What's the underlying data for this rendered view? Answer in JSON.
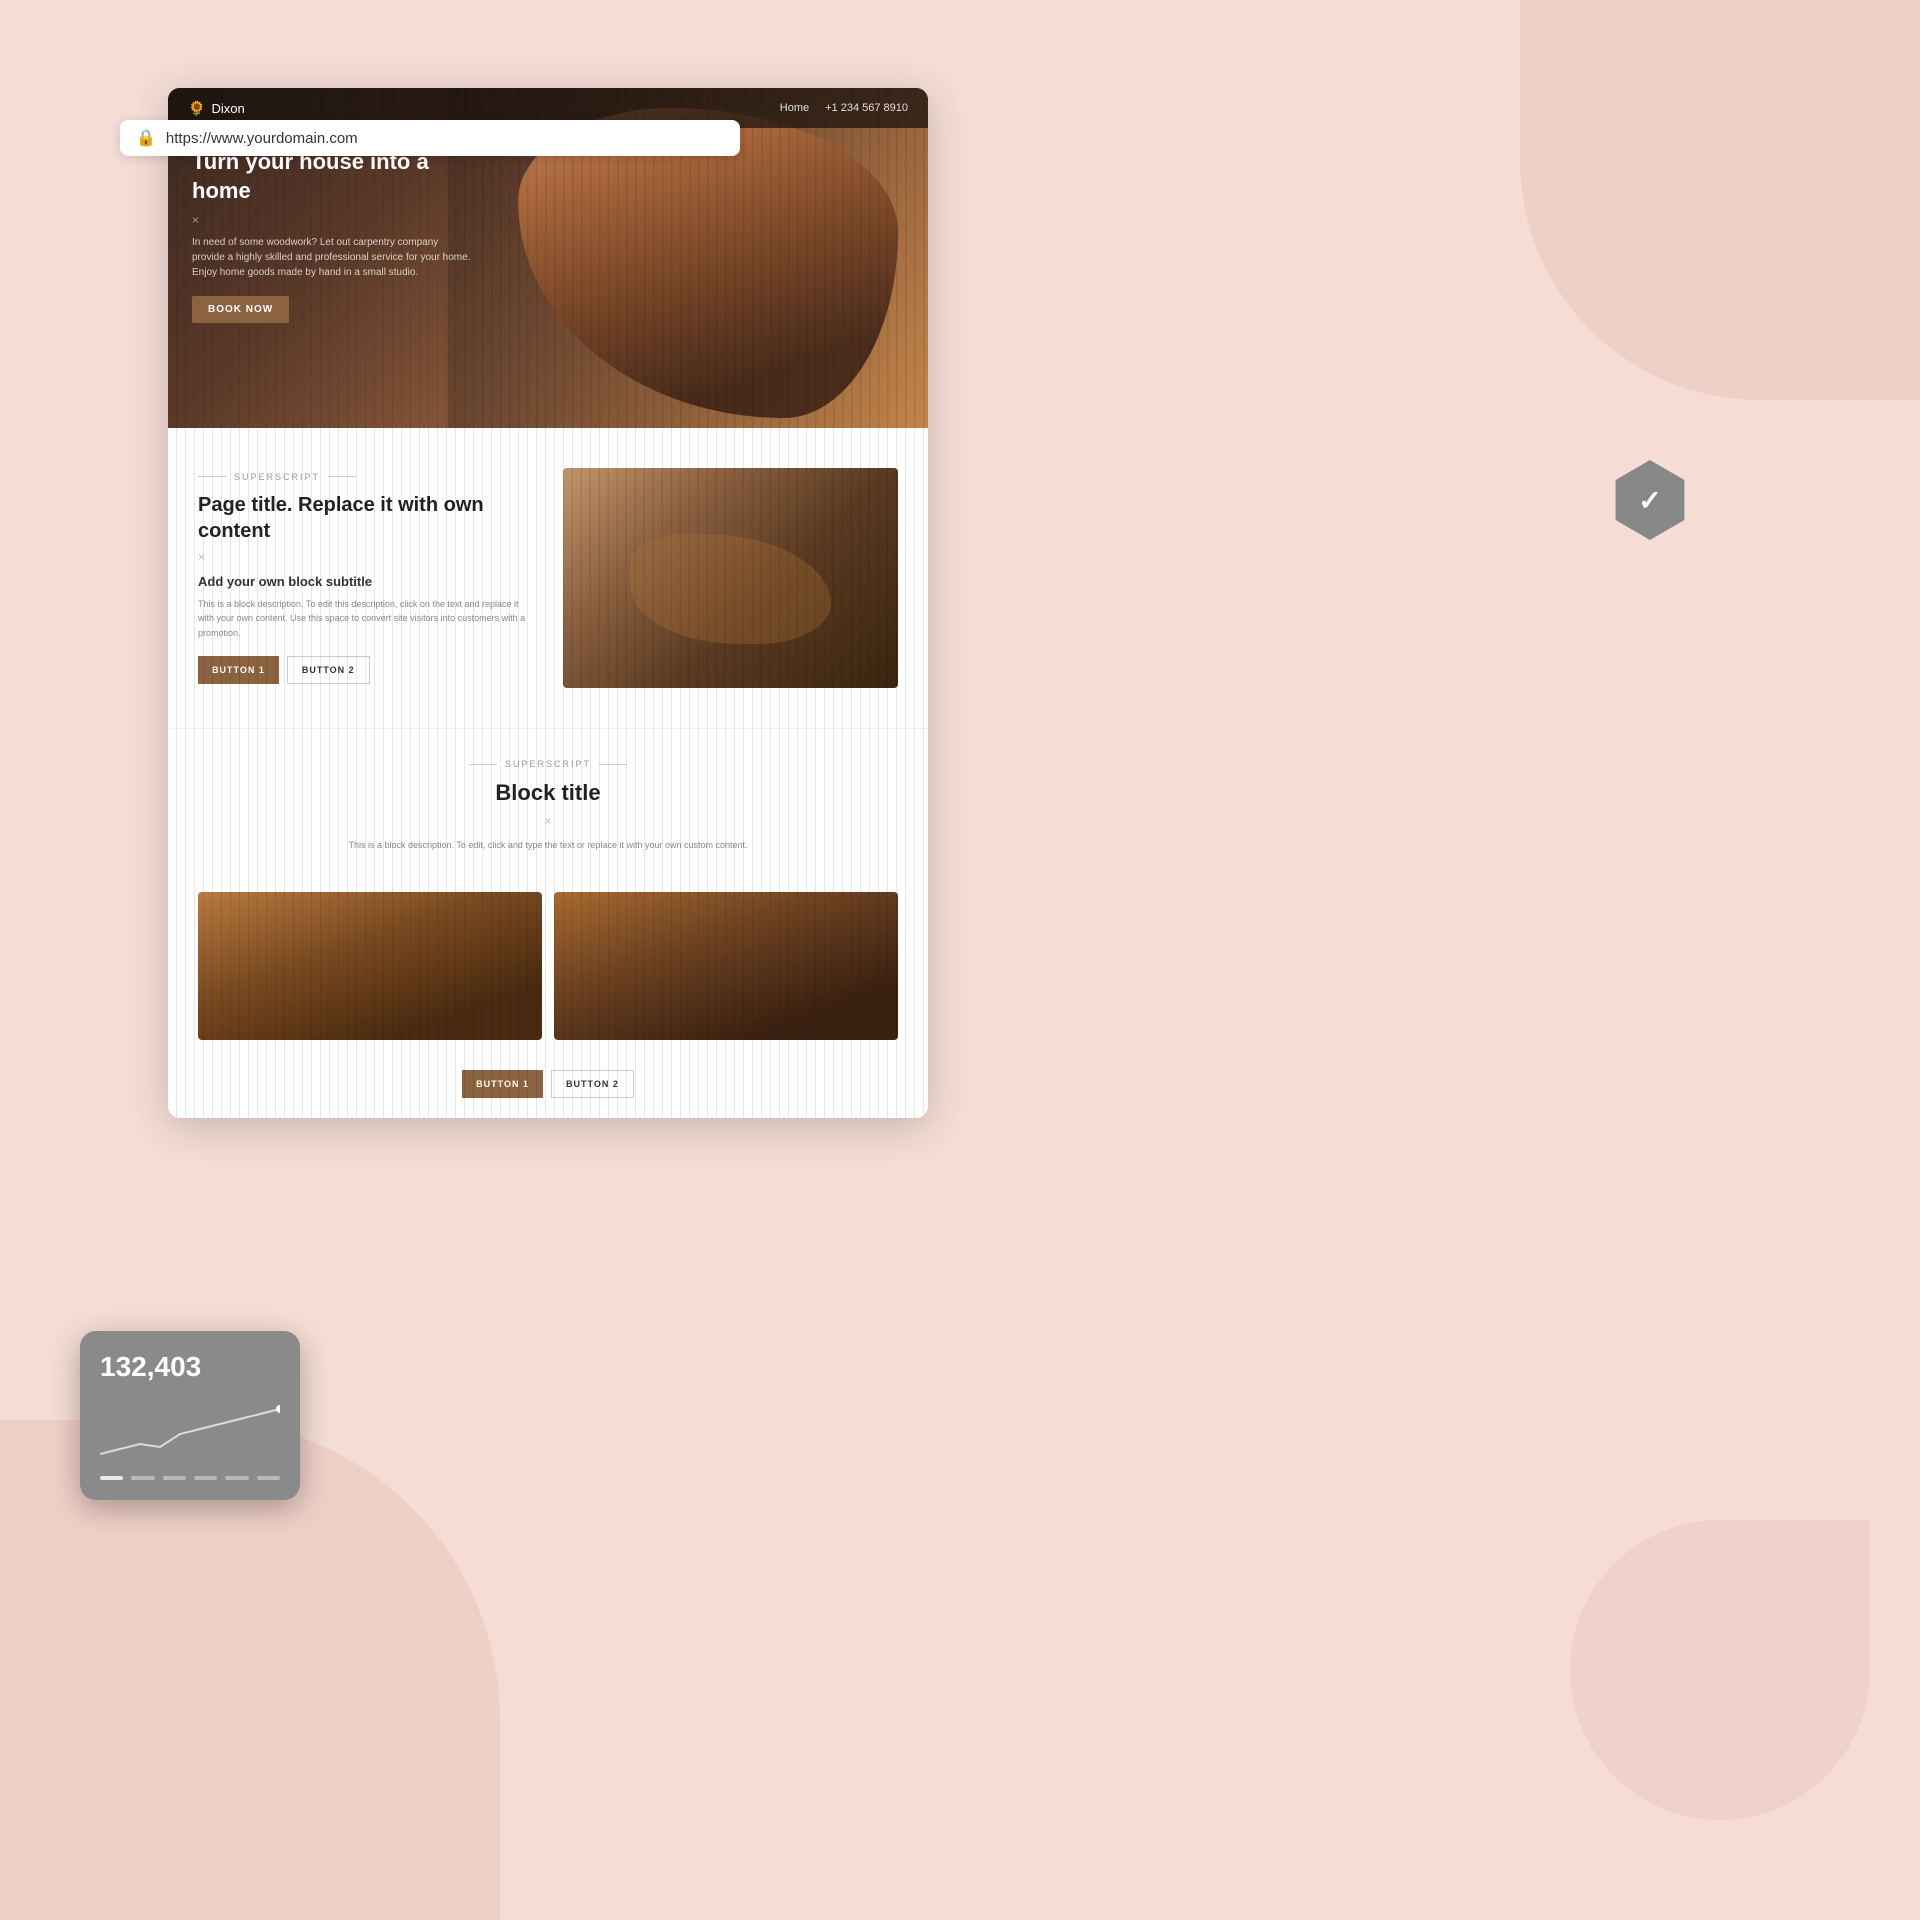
{
  "background": {
    "color": "#f5ddd6"
  },
  "browser": {
    "url": "https://www.yourdomain.com",
    "lock_label": "🔒"
  },
  "nav": {
    "logo": "Dixon",
    "logo_icon": "🌻",
    "links": [
      "Home",
      "+1 234 567 8910"
    ]
  },
  "hero": {
    "title": "Turn your house into a home",
    "x_mark": "×",
    "description": "In need of some woodwork? Let out carpentry company provide a highly skilled and professional service for your home. Enjoy home goods made by hand in a small studio.",
    "cta_label": "BOOK NOW"
  },
  "section1": {
    "superscript": "SUPERSCRIPT",
    "title": "Page title. Replace it with own content",
    "x_mark": "×",
    "subtitle": "Add your own block subtitle",
    "description": "This is a block description. To edit this description, click on the text and replace it with your own content. Use this space to convert site visitors into customers with a promotion.",
    "button1": "BUTTON 1",
    "button2": "BUTTON 2"
  },
  "section2": {
    "superscript": "SUPERSCRIPT",
    "title": "Block title",
    "x_mark": "×",
    "description": "This is a block description. To edit, click and type the text or replace it with your own custom content.",
    "button1": "BUTTON 1",
    "button2": "BUTTON 2"
  },
  "stats": {
    "number": "132,403"
  },
  "check_badge": {
    "icon": "✓"
  }
}
